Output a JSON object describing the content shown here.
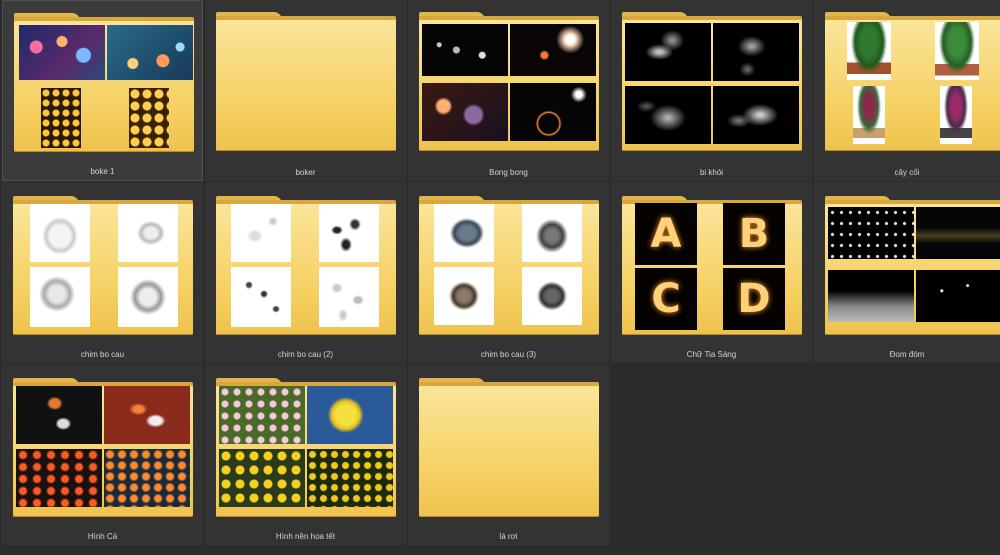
{
  "folders": [
    {
      "name": "boke 1",
      "selected": true,
      "thumb_icon": "bokeh-thumbnails-icon"
    },
    {
      "name": "boker",
      "selected": false,
      "thumb_icon": "empty-folder-icon"
    },
    {
      "name": "Bong bong",
      "selected": false,
      "thumb_icon": "bubble-thumbnails-icon"
    },
    {
      "name": "bi khói",
      "selected": false,
      "thumb_icon": "smoke-thumbnails-icon"
    },
    {
      "name": "cây cối",
      "selected": false,
      "thumb_icon": "plant-thumbnails-icon"
    },
    {
      "name": "chim bo cau",
      "selected": false,
      "thumb_icon": "dove-thumbnails-icon"
    },
    {
      "name": "chim bo cau (2)",
      "selected": false,
      "thumb_icon": "dove-flock-thumbnails-icon"
    },
    {
      "name": "chim bo cau (3)",
      "selected": false,
      "thumb_icon": "pigeon-thumbnails-icon"
    },
    {
      "name": "Chữ Tia Sáng",
      "selected": false,
      "thumb_icon": "sparkler-letters-thumbnails-icon"
    },
    {
      "name": "Đom đóm",
      "selected": false,
      "thumb_icon": "firefly-thumbnails-icon"
    },
    {
      "name": "Hình Cá",
      "selected": false,
      "thumb_icon": "koi-fish-thumbnails-icon"
    },
    {
      "name": "Hình nền hoa tết",
      "selected": false,
      "thumb_icon": "flower-thumbnails-icon"
    },
    {
      "name": "lá rơi",
      "selected": false,
      "thumb_icon": "empty-folder-icon"
    }
  ],
  "colors": {
    "background": "#2b2b2b",
    "tile": "#333333",
    "folder_front": "#f5cf60",
    "folder_back": "#d9a83d",
    "label_text": "#d4d4d4"
  }
}
